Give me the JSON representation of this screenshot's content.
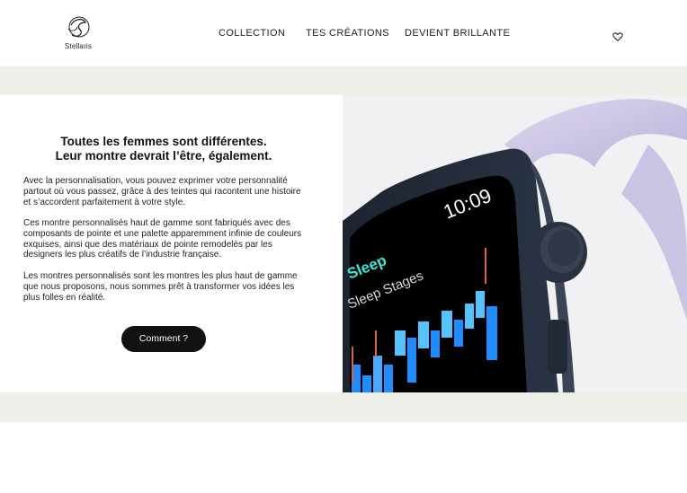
{
  "brand": {
    "name": "Stellaris"
  },
  "nav": {
    "items": [
      {
        "label": "COLLECTION"
      },
      {
        "label": "TES CRÉATIONS"
      },
      {
        "label": "DEVIENT BRILLANTE"
      }
    ]
  },
  "hero": {
    "headline_line1": "Toutes les femmes sont différentes.",
    "headline_line2": "Leur montre devrait l’être, également.",
    "paragraphs": [
      "Avec la personnalisation, vous pouvez exprimer votre personnalité partout où vous passez, grâce à des teintes qui racontent une histoire et s’accordent parfaitement à votre style.",
      "Ces montre personnalisés haut de gamme sont fabriqués avec des composants de pointe et une palette apparemment infinie de couleurs exquises, ainsi que des matériaux de pointe remodelés par les designers les plus créatifs de l’industrie française.",
      "Les montres personnalisés sont les montres les plus haut de gamme que nous proposons, nous sommes prêt à transformer vos idées les plus folles en réalité."
    ],
    "cta_label": "Comment ?"
  },
  "watch": {
    "time": "10:09",
    "app_title": "Sleep",
    "subtitle": "Sleep Stages"
  },
  "icons": {
    "logo": "stellaris-logo-icon",
    "favorite": "heart-icon"
  },
  "colors": {
    "band": "#efefe9",
    "button": "#111111",
    "strap": "#c9c2e2",
    "sleep_accent": "#3fe6d6",
    "sleep_bars": "#1f8cff"
  }
}
